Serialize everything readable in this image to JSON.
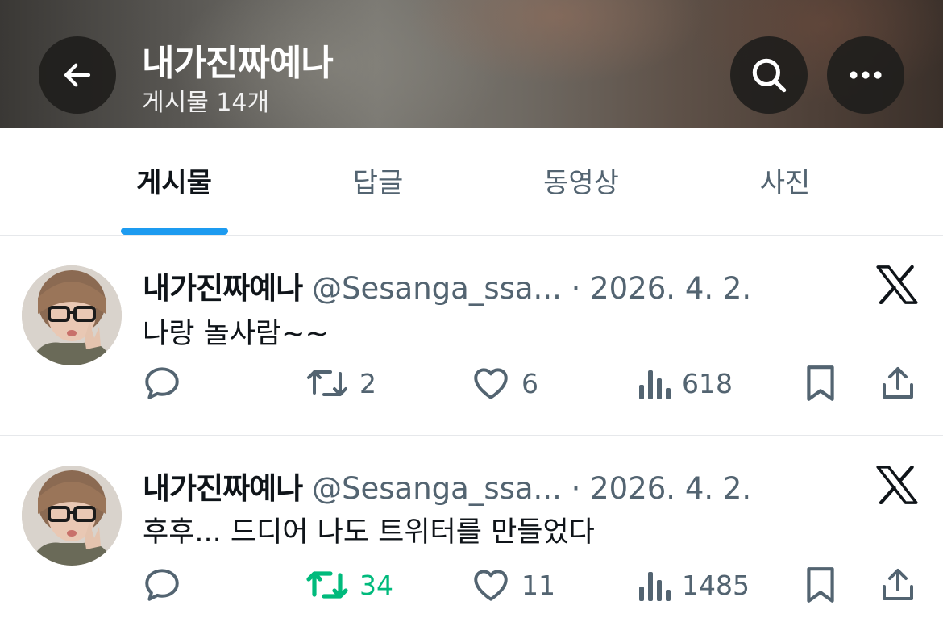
{
  "header": {
    "title": "내가진짜예나",
    "subtitle": "게시물 14개",
    "back_icon": "arrow-left-icon",
    "search_icon": "search-icon",
    "more_icon": "more-horizontal-icon"
  },
  "tabs": [
    {
      "label": "게시물",
      "active": true
    },
    {
      "label": "답글",
      "active": false
    },
    {
      "label": "동영상",
      "active": false
    },
    {
      "label": "사진",
      "active": false
    }
  ],
  "colors": {
    "accent": "#1d9bf0",
    "muted_text": "#536471",
    "repost_active": "#00ba7c",
    "divider": "#e6e8eb"
  },
  "posts": [
    {
      "author_name": "내가진짜예나",
      "handle": "@Sesanga_ssa...",
      "separator": "·",
      "date": "2026. 4. 2.",
      "text": "나랑 놀사람~~",
      "replies": "",
      "reposts": "2",
      "likes": "6",
      "views": "618",
      "reposted_by_me": false
    },
    {
      "author_name": "내가진짜예나",
      "handle": "@Sesanga_ssa...",
      "separator": "·",
      "date": "2026. 4. 2.",
      "text": "후후... 드디어 나도 트위터를 만들었다",
      "replies": "",
      "reposts": "34",
      "likes": "11",
      "views": "1485",
      "reposted_by_me": true
    }
  ]
}
